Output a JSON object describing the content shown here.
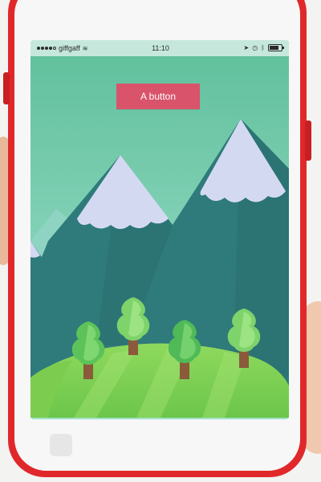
{
  "status_bar": {
    "carrier": "giffgaff",
    "time": "11:10",
    "signal_bars": 4,
    "battery_level": 0.75,
    "icons": [
      "wifi-icon",
      "location-icon",
      "alarm-icon",
      "bluetooth-icon",
      "battery-icon"
    ]
  },
  "app": {
    "button_label": "A button"
  },
  "colors": {
    "phone_case": "#e0282b",
    "sky_top": "#5fbf9b",
    "sky_bottom": "#9fe0cc",
    "mountain": "#2f7a7b",
    "snow": "#d4d9f2",
    "grass": "#8bd65a",
    "tree_leaves": "#7ed36a",
    "button": "#d9536b"
  }
}
